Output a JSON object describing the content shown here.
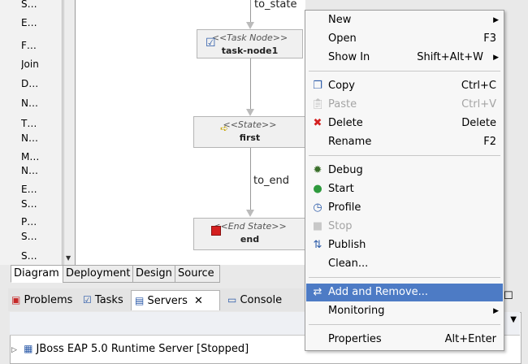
{
  "palette": {
    "items": [
      {
        "icon": "➪",
        "label": "S…"
      },
      {
        "icon": "■",
        "label": "E…"
      },
      {
        "icon": "⚙",
        "label": "F…"
      },
      {
        "icon": "⊶",
        "label": "Join"
      },
      {
        "icon": "◇",
        "label": "D…"
      },
      {
        "icon": "✹",
        "label": "N…"
      },
      {
        "icon": "☑",
        "label": "T…"
      },
      {
        "icon": "",
        "label": "N…"
      },
      {
        "icon": "✉",
        "label": "M…"
      },
      {
        "icon": "",
        "label": "N…"
      },
      {
        "icon": "⚑",
        "label": "E…"
      },
      {
        "icon": "",
        "label": "S…"
      },
      {
        "icon": "⚙",
        "label": "P…"
      },
      {
        "icon": "",
        "label": "S…"
      },
      {
        "icon": "➪",
        "label": "S…"
      }
    ]
  },
  "canvas": {
    "edge_top_label": "to_state",
    "edge_mid_label": "to_end",
    "nodes": [
      {
        "stereotype": "<<Task Node>>",
        "name": "task-node1"
      },
      {
        "stereotype": "<<State>>",
        "name": "first"
      },
      {
        "stereotype": "<<End State>>",
        "name": "end"
      }
    ]
  },
  "editor_tabs": [
    "Diagram",
    "Deployment",
    "Design",
    "Source"
  ],
  "panel": {
    "tabs": [
      "Problems",
      "Tasks",
      "Servers",
      "Console"
    ],
    "server_row": "JBoss EAP 5.0 Runtime Server  [Stopped]"
  },
  "menu": {
    "new": {
      "label": "New",
      "shortcut": ""
    },
    "open": {
      "label": "Open",
      "shortcut": "F3"
    },
    "show_in": {
      "label": "Show In",
      "shortcut": "Shift+Alt+W"
    },
    "copy": {
      "label": "Copy",
      "shortcut": "Ctrl+C"
    },
    "paste": {
      "label": "Paste",
      "shortcut": "Ctrl+V"
    },
    "delete": {
      "label": "Delete",
      "shortcut": "Delete"
    },
    "rename": {
      "label": "Rename",
      "shortcut": "F2"
    },
    "debug": {
      "label": "Debug"
    },
    "start": {
      "label": "Start"
    },
    "profile": {
      "label": "Profile"
    },
    "stop": {
      "label": "Stop"
    },
    "publish": {
      "label": "Publish"
    },
    "clean": {
      "label": "Clean..."
    },
    "add_remove": {
      "label": "Add and Remove..."
    },
    "monitoring": {
      "label": "Monitoring"
    },
    "properties": {
      "label": "Properties",
      "shortcut": "Alt+Enter"
    }
  },
  "colors": {
    "highlight": "#4d7bc5",
    "start_green": "#2e9a3d",
    "delete_red": "#d42020"
  }
}
